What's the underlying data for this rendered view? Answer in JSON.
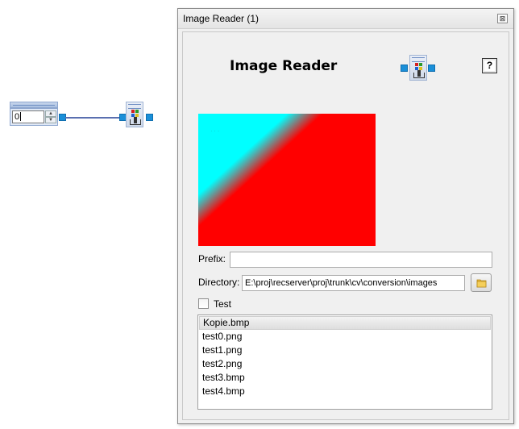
{
  "canvas": {
    "int_node": {
      "value": "0"
    }
  },
  "dialog": {
    "window_title": "Image Reader (1)",
    "close_glyph": "⊠",
    "header_title": "Image Reader",
    "help_glyph": "?",
    "preview": {
      "colors": {
        "primary": "#00ffff",
        "secondary": "#ff0000"
      }
    },
    "form": {
      "prefix_label": "Prefix:",
      "prefix_value": "",
      "directory_label": "Directory:",
      "directory_value": "E:\\proj\\recserver\\proj\\trunk\\cv\\conversion\\images",
      "test_label": "Test",
      "test_checked": false
    },
    "files": [
      {
        "name": "Kopie.bmp",
        "selected": true
      },
      {
        "name": "test0.png",
        "selected": false
      },
      {
        "name": "test1.png",
        "selected": false
      },
      {
        "name": "test2.png",
        "selected": false
      },
      {
        "name": "test3.bmp",
        "selected": false
      },
      {
        "name": "test4.bmp",
        "selected": false
      }
    ]
  },
  "icons": {
    "node_port": "square-port-icon",
    "reader": "image-reader-icon",
    "folder": "folder-icon",
    "help": "help-icon",
    "close": "close-icon"
  },
  "colors": {
    "port": "#1a8fd8",
    "wire": "#5a6fb0",
    "node_header": "#a9bfe0"
  }
}
